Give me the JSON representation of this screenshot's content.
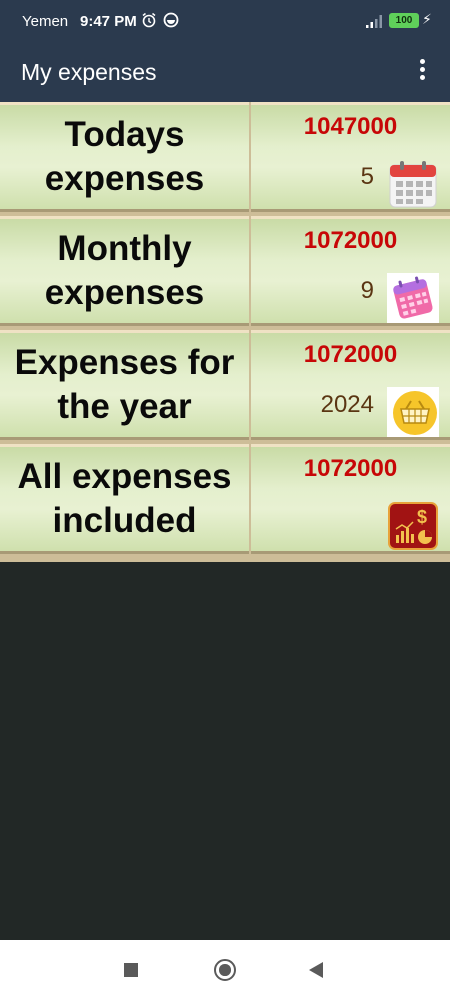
{
  "status_bar": {
    "carrier": "Yemen",
    "time": "9:47 PM",
    "battery": "100"
  },
  "app_bar": {
    "title": "My expenses"
  },
  "rows": [
    {
      "label": "Todays expenses",
      "amount": "1047000",
      "count": "5",
      "icon": "calendar-icon"
    },
    {
      "label": "Monthly expenses",
      "amount": "1072000",
      "count": "9",
      "icon": "pink-calendar-icon"
    },
    {
      "label": "Expenses for the year",
      "amount": "1072000",
      "count": "2024",
      "icon": "basket-icon"
    },
    {
      "label": "All expenses included",
      "amount": "1072000",
      "count": "",
      "icon": "finance-chart-icon"
    }
  ],
  "colors": {
    "app_bar": "#2b3a4e",
    "amount": "#c70707",
    "count": "#5a3512",
    "row_bg": "#e4efcd"
  }
}
